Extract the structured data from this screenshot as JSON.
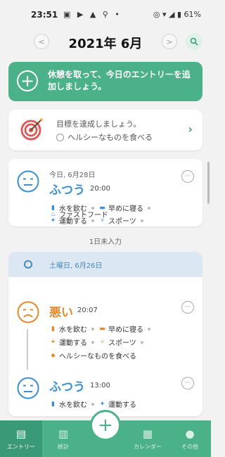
{
  "status_bar": {
    "time": "23:51",
    "icons": "▣ ▶ ▲ ⚲ •",
    "right": "◎ ▾ ◢ ▮ 61%"
  },
  "header": {
    "month": "2021年 6月",
    "prev_icon": "chevron-left-icon",
    "next_icon": "chevron-right-icon",
    "search_icon": "search-icon"
  },
  "banner": {
    "text": "休憩を取って、今日のエントリーを追加しましょう。"
  },
  "goal": {
    "title": "目標を達成しましょう。",
    "item": "ヘルシーなものを食べる"
  },
  "entries": [
    {
      "date": "今日, 6月28日",
      "mood": "ふつう",
      "time": "20:00",
      "activities": [
        "水を飲む",
        "早めに寝る",
        "運動する",
        "スポーツ",
        "ファストフード"
      ]
    }
  ],
  "unrecorded": "1日未入力",
  "day": {
    "label": "土曜日, 6月26日",
    "entries": [
      {
        "mood": "悪い",
        "time": "20:07",
        "activities": [
          "水を飲む",
          "早めに寝る",
          "運動する",
          "スポーツ",
          "ヘルシーなものを食べる"
        ]
      },
      {
        "mood": "ふつう",
        "time": "13:00",
        "activities": [
          "水を飲む",
          "運動する"
        ]
      }
    ]
  },
  "colors": {
    "accent": "#4bb189",
    "mood_normal": "#3b8fd3",
    "mood_bad": "#e38b2c",
    "day_bar": "#dbe8f3"
  },
  "nav": {
    "items": [
      "エントリー",
      "統計",
      "カレンダー",
      "その他"
    ],
    "active": "エントリー"
  }
}
